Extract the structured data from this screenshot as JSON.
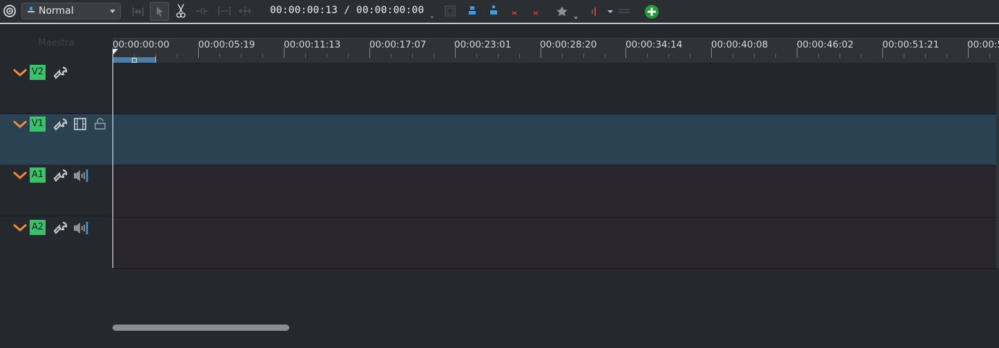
{
  "toolbar": {
    "mode_label": "Normal",
    "timecode": "00:00:00:13 / 00:00:00:00",
    "icons": [
      "timeline-settings-icon",
      "mode-icon",
      "spacer-tool-icon",
      "selection-tool-icon",
      "razor-tool-icon",
      "ripple-icon",
      "rolling-icon",
      "slip-icon",
      "snap-icon",
      "insert-icon",
      "overwrite-icon",
      "lift-icon",
      "extract-icon",
      "favorite-icon",
      "audio-icon",
      "zoom-icon",
      "add-track-icon"
    ],
    "accent": "#3ba0e6",
    "add_color": "#1f9d3a"
  },
  "headers": {
    "master_label": "Maestra"
  },
  "tracks": [
    {
      "name": "V2",
      "type": "video",
      "icons": [
        "wrench-icon"
      ]
    },
    {
      "name": "V1",
      "type": "video",
      "icons": [
        "wrench-icon",
        "film-icon",
        "lock-icon"
      ],
      "selected": true
    },
    {
      "name": "A1",
      "type": "audio",
      "icons": [
        "wrench-icon",
        "speaker-icon"
      ]
    },
    {
      "name": "A2",
      "type": "audio",
      "icons": [
        "wrench-icon",
        "speaker-icon"
      ]
    }
  ],
  "track_colors": {
    "name_badge": "#35c46a",
    "chevron": "#f28a3c",
    "selected_lane": "#2a4252"
  },
  "ruler": {
    "labels": [
      "00:00:00:00",
      "00:00:05:19",
      "00:00:11:13",
      "00:00:17:07",
      "00:00:23:01",
      "00:00:28:20",
      "00:00:34:14",
      "00:00:40:08",
      "00:00:46:02",
      "00:00:51:21",
      "00:00:5"
    ]
  }
}
